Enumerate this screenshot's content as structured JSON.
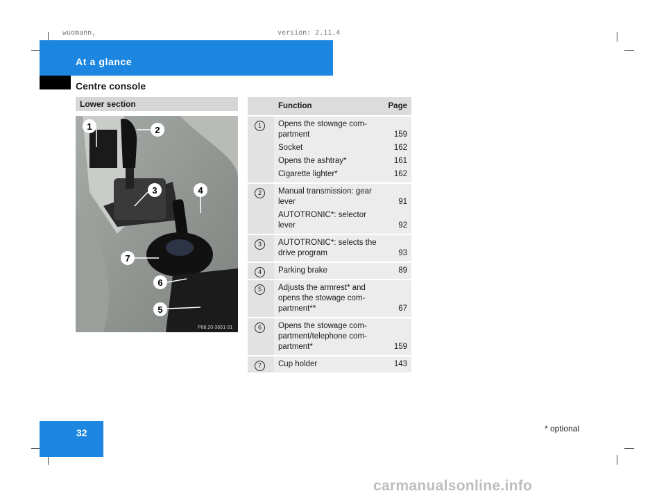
{
  "meta": {
    "left_text": "wuomann,",
    "right_text": "version: 2.11.4"
  },
  "header": {
    "title": "At a glance",
    "section": "Centre console"
  },
  "lower_section": {
    "label": "Lower section"
  },
  "photo": {
    "code": "P68.20-3651-31",
    "callouts": [
      "1",
      "2",
      "3",
      "4",
      "5",
      "6",
      "7"
    ]
  },
  "table": {
    "headers": {
      "function": "Function",
      "page": "Page"
    },
    "rows": [
      {
        "num": "1",
        "items": [
          {
            "text": "Opens the stowage com-\npartment",
            "page": "159"
          },
          {
            "text": "Socket",
            "page": "162"
          },
          {
            "text": "Opens the ashtray*",
            "page": "161"
          },
          {
            "text": "Cigarette lighter*",
            "page": "162"
          }
        ]
      },
      {
        "num": "2",
        "items": [
          {
            "text": "Manual transmission: gear\nlever",
            "page": "91"
          },
          {
            "text": "AUTOTRONIC*: selector\nlever",
            "page": "92"
          }
        ]
      },
      {
        "num": "3",
        "items": [
          {
            "text": "AUTOTRONIC*: selects the\ndrive program",
            "page": "93"
          }
        ]
      },
      {
        "num": "4",
        "items": [
          {
            "text": "Parking brake",
            "page": "89"
          }
        ]
      },
      {
        "num": "5",
        "items": [
          {
            "text": "Adjusts the armrest* and\nopens the stowage com-\npartment**",
            "page": "67"
          }
        ]
      },
      {
        "num": "6",
        "items": [
          {
            "text": "Opens the stowage com-\npartment/telephone com-\npartment*",
            "page": "159"
          }
        ]
      },
      {
        "num": "7",
        "items": [
          {
            "text": "Cup holder",
            "page": "143"
          }
        ]
      }
    ]
  },
  "footer": {
    "page_number": "32",
    "optional_note": "* optional",
    "watermark": "carmanualsonline.info"
  }
}
